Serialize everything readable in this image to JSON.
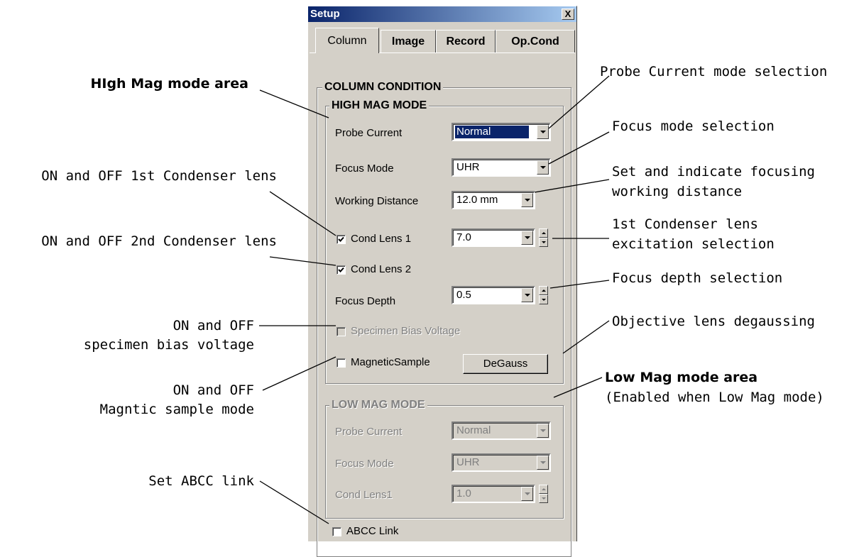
{
  "window": {
    "title": "Setup",
    "close_glyph": "X"
  },
  "tabs": [
    {
      "label": "Column",
      "active": true
    },
    {
      "label": "Image",
      "active": false
    },
    {
      "label": "Record",
      "active": false
    },
    {
      "label": "Op.Cond",
      "active": false
    }
  ],
  "column_condition": {
    "title": "COLUMN CONDITION",
    "high_mag": {
      "title": "HIGH MAG MODE",
      "probe_current": {
        "label": "Probe Current",
        "value": "Normal"
      },
      "focus_mode": {
        "label": "Focus Mode",
        "value": "UHR"
      },
      "working_distance": {
        "label": "Working Distance",
        "value": "12.0 mm"
      },
      "cond_lens_1": {
        "label": "Cond Lens 1",
        "checked": true,
        "value": "7.0"
      },
      "cond_lens_2": {
        "label": "Cond Lens 2",
        "checked": true
      },
      "focus_depth": {
        "label": "Focus Depth",
        "value": "0.5"
      },
      "specimen_bias": {
        "label": "Specimen Bias Voltage",
        "checked": false,
        "enabled": false
      },
      "magnetic_sample": {
        "label": "MagneticSample",
        "checked": false
      },
      "degauss_button": "DeGauss"
    },
    "low_mag": {
      "title": "LOW MAG MODE",
      "enabled": false,
      "probe_current": {
        "label": "Probe Current",
        "value": "Normal"
      },
      "focus_mode": {
        "label": "Focus Mode",
        "value": "UHR"
      },
      "cond_lens_1": {
        "label": "Cond Lens1",
        "value": "1.0"
      }
    },
    "abcc_link": {
      "label": "ABCC Link",
      "checked": false
    }
  },
  "annotations": {
    "left": {
      "high_mag_area": "HIgh Mag mode area",
      "cond_lens_1": "ON and OFF 1st Condenser lens",
      "cond_lens_2": "ON and OFF 2nd Condenser lens",
      "bias_1": "ON and OFF",
      "bias_2": "specimen bias voltage",
      "magnetic_1": "ON and OFF",
      "magnetic_2": "Magntic sample mode",
      "abcc": "Set ABCC link"
    },
    "right": {
      "probe_current": "Probe Current mode selection",
      "focus_mode": "Focus mode selection",
      "wd_1": "Set and indicate focusing",
      "wd_2": "working distance",
      "cond1_exc_1": "1st Condenser lens",
      "cond1_exc_2": "excitation selection",
      "focus_depth": "Focus depth selection",
      "degauss": "Objective lens degaussing",
      "low_mag_area": "Low Mag mode area",
      "low_mag_note": "(Enabled when Low Mag mode)"
    }
  }
}
